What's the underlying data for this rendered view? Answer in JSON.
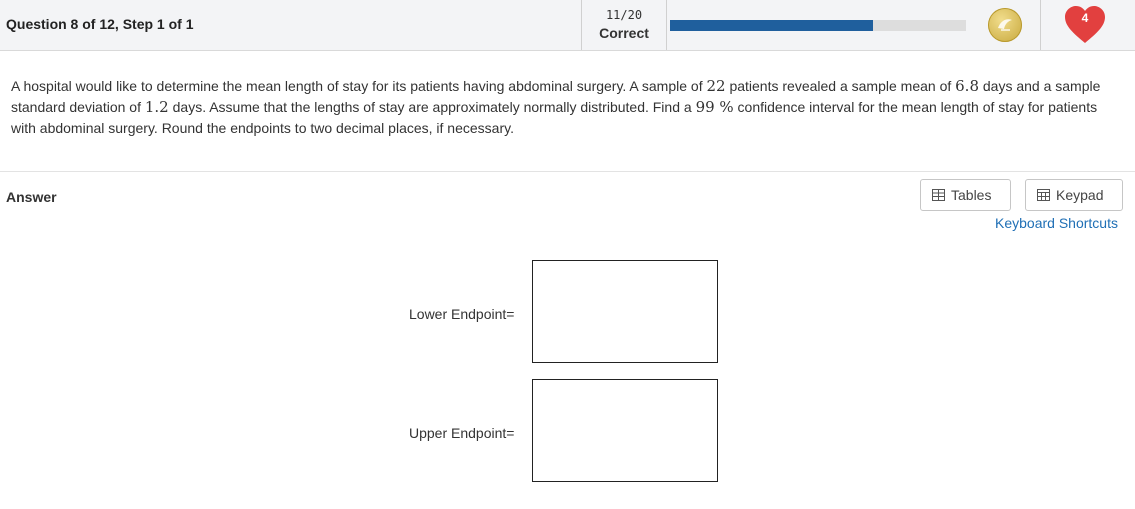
{
  "header": {
    "question_label": "Question 8 of 12, Step 1 of 1",
    "score_fraction": "11/20",
    "score_status": "Correct",
    "progress": 0.686,
    "hearts": "4",
    "icons": {
      "badge": "trophy-badge-icon",
      "heart": "heart-icon"
    }
  },
  "question": {
    "p1": "A hospital would like to determine the mean length of stay for its patients having abdominal surgery. A sample of ",
    "n": "22",
    "p2": " patients revealed a sample mean of ",
    "mean": "6.8",
    "p3": " days and a sample standard deviation of ",
    "sd": "1.2",
    "p4": " days. Assume that the lengths of stay are approximately normally distributed. Find a ",
    "conf": "99 %",
    "p5": " confidence interval for the mean length of stay for patients with abdominal surgery. Round the endpoints to two decimal places, if necessary."
  },
  "answer": {
    "label": "Answer",
    "tables_label": "Tables",
    "keypad_label": "Keypad",
    "shortcuts_label": "Keyboard Shortcuts",
    "lower_label": "Lower Endpoint=",
    "upper_label": "Upper Endpoint=",
    "lower_value": "",
    "upper_value": ""
  },
  "colors": {
    "progress_fill": "#1f5f9d",
    "heart": "#e2403f",
    "link": "#1f6fb5",
    "badge": "#c7a73b"
  }
}
